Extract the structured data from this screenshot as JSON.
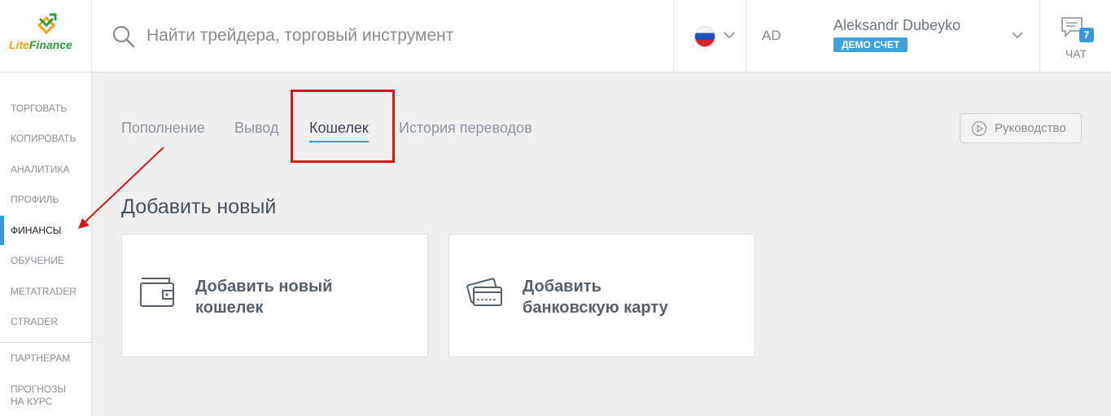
{
  "brand": {
    "name_part1": "Lite",
    "name_part2": "Finance"
  },
  "search": {
    "placeholder": "Найти трейдера, торговый инструмент"
  },
  "language": {
    "flag_icon": "russia-flag-icon"
  },
  "user": {
    "initials": "AD",
    "name": "Aleksandr Dubeyko",
    "account_type": "ДЕМО СЧЕТ"
  },
  "chat": {
    "label": "ЧАТ",
    "unread_count": "7"
  },
  "sidebar": {
    "items": [
      {
        "label": "ТОРГОВАТЬ"
      },
      {
        "label": "КОПИРОВАТЬ"
      },
      {
        "label": "АНАЛИТИКА"
      },
      {
        "label": "ПРОФИЛЬ"
      },
      {
        "label": "ФИНАНСЫ",
        "active": true
      },
      {
        "label": "ОБУЧЕНИЕ"
      },
      {
        "label": "METATRADER"
      },
      {
        "label": "CTRADER"
      },
      {
        "label": "ПАРТНЕРАМ"
      },
      {
        "label_line1": "ПРОГНОЗЫ",
        "label_line2": "НА КУРС"
      }
    ]
  },
  "tabs": [
    {
      "label": "Пополнение"
    },
    {
      "label": "Вывод"
    },
    {
      "label": "Кошелек",
      "active": true
    },
    {
      "label": "История переводов"
    }
  ],
  "guide": {
    "label": "Руководство"
  },
  "main": {
    "section_title": "Добавить новый",
    "cards": [
      {
        "line1": "Добавить новый",
        "line2": "кошелек",
        "icon": "wallet-icon"
      },
      {
        "line1": "Добавить",
        "line2": "банковскую карту",
        "icon": "bank-card-icon"
      }
    ]
  },
  "colors": {
    "accent": "#3a9ad9",
    "annotation_red": "#d9141c",
    "badge": "#3fa1d9"
  }
}
